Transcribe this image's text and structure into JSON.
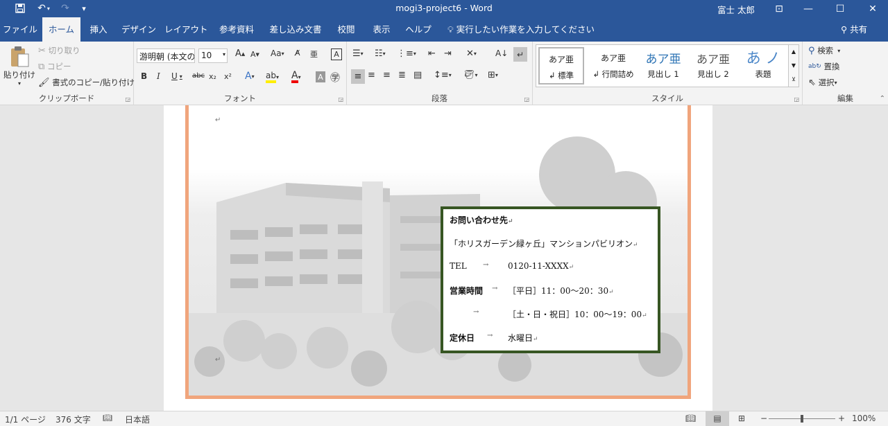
{
  "title_bar": {
    "document_title": "mogi3-project6 - Word",
    "user_name": "富士 太郎",
    "minimize": "—",
    "maximize": "☐",
    "close": "✕",
    "ribbon_display": "⊡",
    "save_icon": "save-icon",
    "undo_icon": "undo-icon",
    "redo_icon": "redo-icon"
  },
  "tabs": [
    {
      "label": "ファイル"
    },
    {
      "label": "ホーム"
    },
    {
      "label": "挿入"
    },
    {
      "label": "デザイン"
    },
    {
      "label": "レイアウト"
    },
    {
      "label": "参考資料"
    },
    {
      "label": "差し込み文書"
    },
    {
      "label": "校閲"
    },
    {
      "label": "表示"
    },
    {
      "label": "ヘルプ"
    }
  ],
  "tell_me": "実行したい作業を入力してください",
  "share": "共有",
  "clipboard": {
    "paste": "貼り付け",
    "cut": "切り取り",
    "copy": "コピー",
    "format_painter": "書式のコピー/貼り付け",
    "label": "クリップボード"
  },
  "font": {
    "name": "游明朝 (本文の",
    "size": "10",
    "grow": "A",
    "shrink": "A",
    "case": "Aa",
    "bold": "B",
    "italic": "I",
    "underline": "U",
    "strike": "abc",
    "subscript": "x₂",
    "superscript": "x²",
    "label": "フォント"
  },
  "paragraph": {
    "label": "段落"
  },
  "styles": {
    "items": [
      {
        "preview": "あア亜",
        "name": "↲ 標準"
      },
      {
        "preview": "あア亜",
        "name": "↲ 行間詰め"
      },
      {
        "preview": "あア亜",
        "name": "見出し 1"
      },
      {
        "preview": "あア亜",
        "name": "見出し 2"
      },
      {
        "preview": "あ ノ",
        "name": "表題"
      }
    ],
    "label": "スタイル"
  },
  "editing": {
    "find": "検索",
    "replace": "置換",
    "select": "選択",
    "label": "編集"
  },
  "document": {
    "para_mark": "↵",
    "info_box": {
      "heading": "お問い合わせ先",
      "name": "「ホリスガーデン緑ヶ丘」マンションパビリオン",
      "tel_label": "TEL",
      "tel_value": "0120-11-XXXX",
      "hours_label": "営業時間",
      "hours_weekday": "［平日］11：00～20：30",
      "hours_weekend": "［土・日・祝日］10：00～19：00",
      "closed_label": "定休日",
      "closed_value": "水曜日",
      "tab_arrow": "→"
    }
  },
  "status": {
    "page": "1/1 ページ",
    "words": "376 文字",
    "language": "日本語",
    "zoom": "100%"
  },
  "colors": {
    "title_bar": "#2b579a",
    "frame": "#f0a57c",
    "box_border": "#375623"
  }
}
